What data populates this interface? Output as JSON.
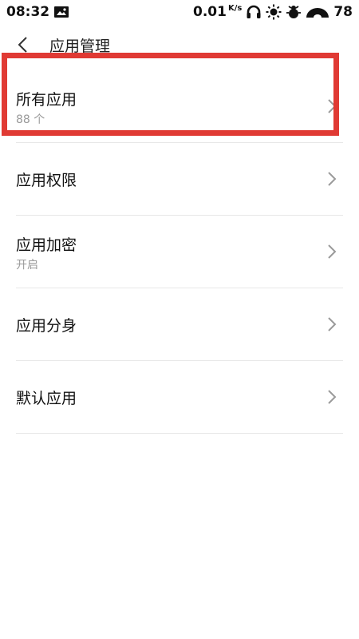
{
  "status_bar": {
    "time": "08:32",
    "net_speed": "0.01",
    "net_speed_unit": "K/s",
    "battery": "78",
    "icons": [
      "image-notification-icon",
      "headset-icon",
      "brightness-icon",
      "bug-icon",
      "signal-icon"
    ]
  },
  "header": {
    "title": "应用管理",
    "back_icon": "back-arrow-icon"
  },
  "items": [
    {
      "title": "所有应用",
      "subtitle": "88 个"
    },
    {
      "title": "应用权限",
      "subtitle": ""
    },
    {
      "title": "应用加密",
      "subtitle": "开启"
    },
    {
      "title": "应用分身",
      "subtitle": ""
    },
    {
      "title": "默认应用",
      "subtitle": ""
    }
  ],
  "colors": {
    "highlight": "#e03a34",
    "divider": "#e8e8e8",
    "subtitle": "#9a9a9a",
    "chevron": "#9a9a9a"
  }
}
